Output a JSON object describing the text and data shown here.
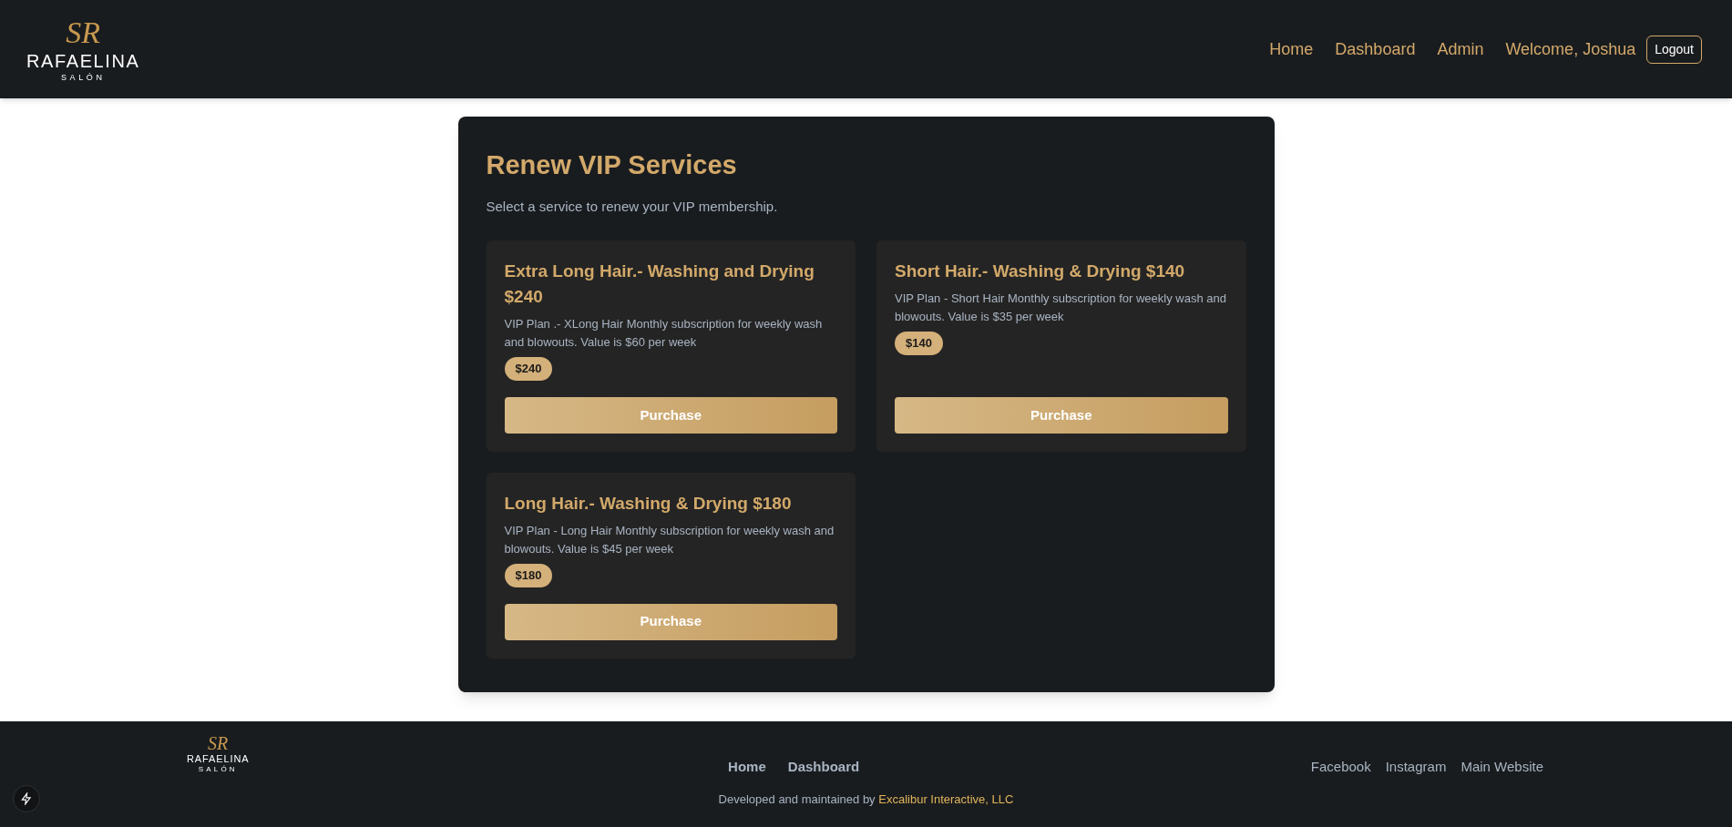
{
  "header": {
    "logo": {
      "monogram": "SR",
      "name": "RAFAELINA",
      "subtitle": "SALÓN"
    },
    "nav": [
      "Home",
      "Dashboard",
      "Admin"
    ],
    "welcome": "Welcome, Joshua",
    "logout": "Logout"
  },
  "panel": {
    "title": "Renew VIP Services",
    "subtitle": "Select a service to renew your VIP membership.",
    "services": [
      {
        "title": "Extra Long Hair.- Washing and Drying $240",
        "description": "VIP Plan .- XLong Hair Monthly subscription for weekly wash and blowouts. Value is $60 per week",
        "price": "$240",
        "button": "Purchase"
      },
      {
        "title": "Short Hair.- Washing & Drying $140",
        "description": "VIP Plan - Short Hair Monthly subscription for weekly wash and blowouts. Value is $35 per week",
        "price": "$140",
        "button": "Purchase"
      },
      {
        "title": "Long Hair.- Washing & Drying $180",
        "description": "VIP Plan - Long Hair Monthly subscription for weekly wash and blowouts. Value is $45 per week",
        "price": "$180",
        "button": "Purchase"
      }
    ]
  },
  "footer": {
    "logo": {
      "monogram": "SR",
      "name": "RAFAELINA",
      "subtitle": "SALÓN"
    },
    "nav": [
      "Home",
      "Dashboard"
    ],
    "social": [
      "Facebook",
      "Instagram",
      "Main Website"
    ],
    "credit": "Developed and maintained by",
    "credit_link": "Excalibur Interactive, LLC"
  }
}
